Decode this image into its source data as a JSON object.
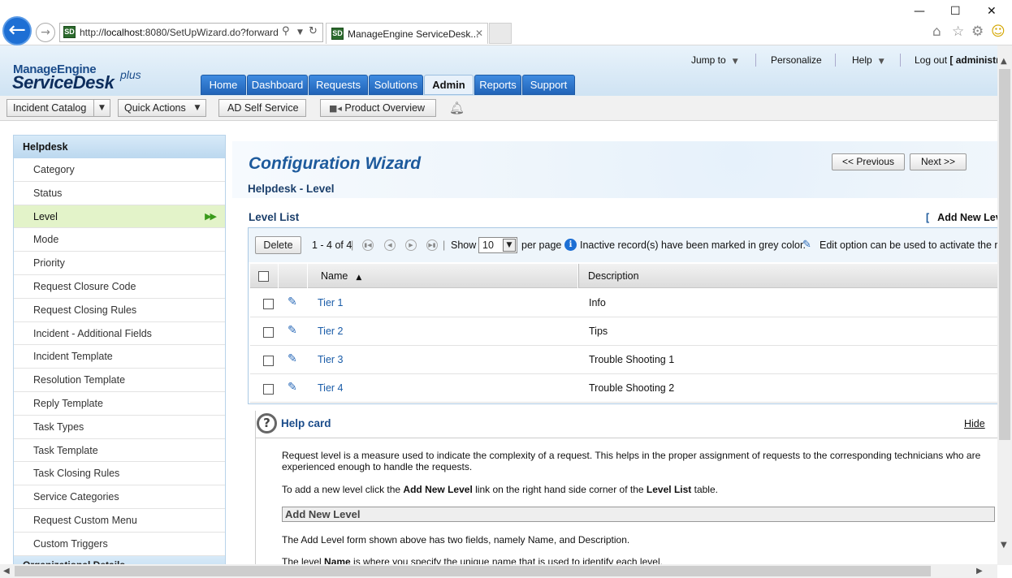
{
  "browser": {
    "url_prefix": "http://",
    "url_host": "localhost",
    "url_rest": ":8080/SetUpWizard.do?forward",
    "tab_title": "ManageEngine ServiceDesk...",
    "tab_close": "✕",
    "favicon": "SD",
    "icons": [
      "back-icon",
      "forward-icon",
      "search-icon",
      "dropdown-icon",
      "refresh-icon",
      "home-icon",
      "star-icon",
      "gear-icon",
      "smiley-icon"
    ],
    "win_min": "—",
    "win_max": "☐",
    "win_close": "✕"
  },
  "app": {
    "logo_top": "ManageEngine",
    "logo_main": "ServiceDesk",
    "logo_plus": "plus",
    "nav_tabs": [
      {
        "label": "Home"
      },
      {
        "label": "Dashboard"
      },
      {
        "label": "Requests"
      },
      {
        "label": "Solutions"
      },
      {
        "label": "Admin"
      },
      {
        "label": "Reports"
      },
      {
        "label": "Support"
      }
    ],
    "active_tab": "Admin",
    "top_links": {
      "jump_to": "Jump to",
      "personalize": "Personalize",
      "help": "Help",
      "logout": "Log out",
      "user": "[ administr"
    }
  },
  "toolbar": {
    "incident_catalog": "Incident Catalog",
    "quick_actions": "Quick Actions",
    "ad_self_service": "AD Self Service",
    "product_overview": "Product Overview"
  },
  "sidebar": {
    "heading": "Helpdesk",
    "items": [
      {
        "label": "Category"
      },
      {
        "label": "Status"
      },
      {
        "label": "Level"
      },
      {
        "label": "Mode"
      },
      {
        "label": "Priority"
      },
      {
        "label": "Request Closure Code"
      },
      {
        "label": "Request Closing Rules"
      },
      {
        "label": "Incident - Additional Fields"
      },
      {
        "label": "Incident Template"
      },
      {
        "label": "Resolution Template"
      },
      {
        "label": "Reply Template"
      },
      {
        "label": "Task Types"
      },
      {
        "label": "Task Template"
      },
      {
        "label": "Task Closing Rules"
      },
      {
        "label": "Service Categories"
      },
      {
        "label": "Request Custom Menu"
      },
      {
        "label": "Custom Triggers"
      }
    ],
    "active_item": "Level",
    "footer": "Organizational Details"
  },
  "wizard": {
    "title": "Configuration Wizard",
    "previous": "<< Previous",
    "next": "Next >>",
    "subtitle": "Helpdesk - Level"
  },
  "level_list": {
    "title": "Level List",
    "add_new_bracket": "[",
    "add_new": "Add New Lev",
    "delete": "Delete",
    "range": "1 - 4 of 4",
    "pipe": "|",
    "show": "Show",
    "per_page_value": "10",
    "per_page": "per page",
    "inactive_note": "Inactive record(s) have been marked in grey color.",
    "edit_note": "Edit option can be used to activate the re",
    "columns": {
      "name": "Name",
      "description": "Description"
    },
    "rows": [
      {
        "name": "Tier 1",
        "description": "Info"
      },
      {
        "name": "Tier 2",
        "description": "Tips"
      },
      {
        "name": "Tier 3",
        "description": "Trouble Shooting 1"
      },
      {
        "name": "Tier 4",
        "description": "Trouble Shooting 2"
      }
    ]
  },
  "help_card": {
    "title": "Help card",
    "hide": "Hide",
    "p1": "Request level is a measure used to indicate the complexity of a request. This helps in the proper assignment of requests to the corresponding technicians who are experienced enough to handle the requests.",
    "p2_a": "To add a new level click the ",
    "p2_b": "Add New Level",
    "p2_c": " link on the right hand side corner of the ",
    "p2_d": "Level List",
    "p2_e": " table.",
    "section": "Add New Level",
    "p3": "The Add Level form shown above has two fields, namely Name, and Description.",
    "p4_a": "The level ",
    "p4_b": "Name",
    "p4_c": " is where you specify the unique name that is used to identify each level."
  },
  "colors": {
    "accent": "#2164b8",
    "active_sidebar": "#e3f3c9",
    "link": "#1a5ca8"
  }
}
